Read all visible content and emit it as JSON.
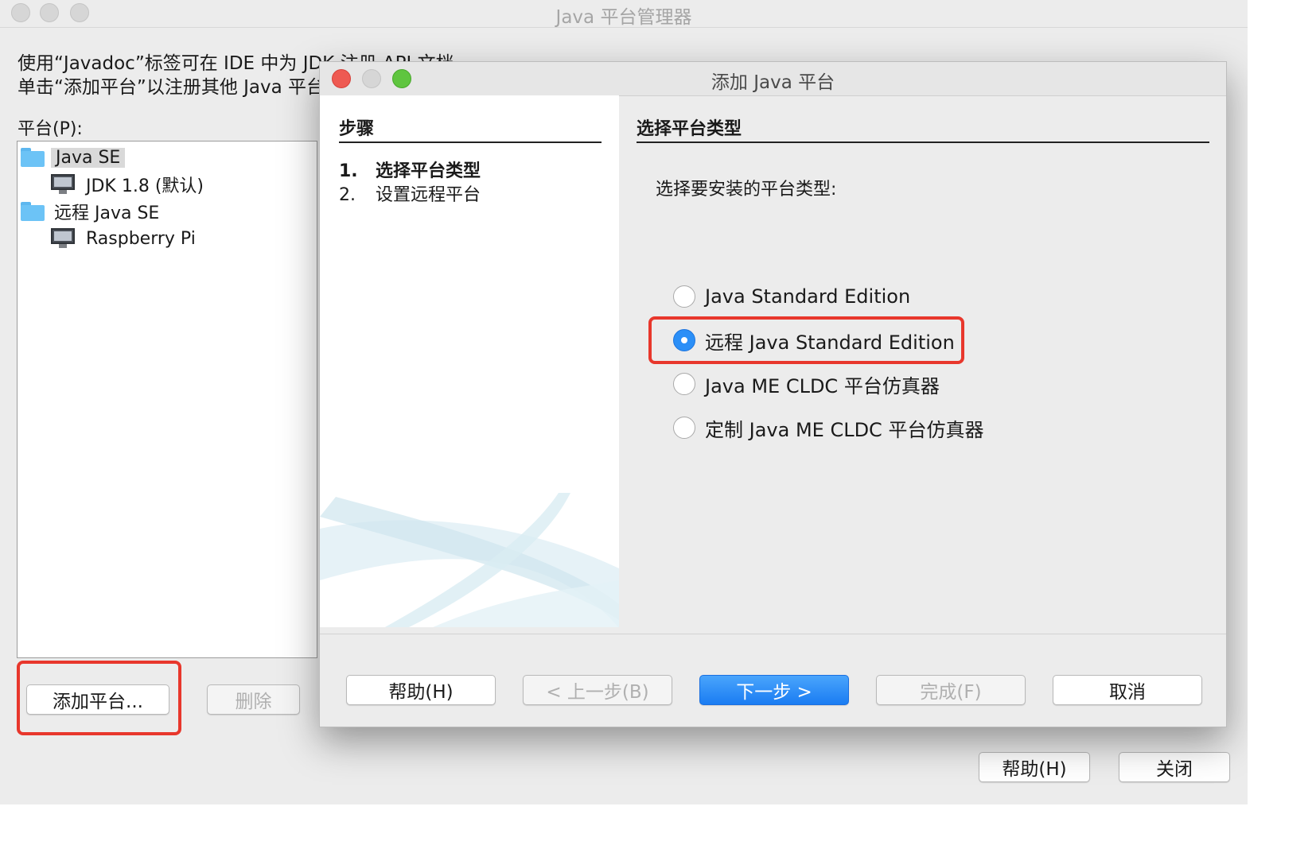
{
  "main_window": {
    "title": "Java 平台管理器",
    "instructions": [
      "使用“Javadoc”标签可在 IDE 中为 JDK 注册 API 文档",
      "单击“添加平台”以注册其他 Java 平台"
    ],
    "platforms_label": "平台(P):",
    "tree": [
      {
        "label": "Java SE",
        "type": "folder",
        "level": 0,
        "selected": true
      },
      {
        "label": "JDK 1.8 (默认)",
        "type": "platform",
        "level": 1
      },
      {
        "label": "远程 Java SE",
        "type": "folder",
        "level": 0
      },
      {
        "label": "Raspberry Pi",
        "type": "platform",
        "level": 1
      }
    ],
    "add_platform_button": "添加平台...",
    "remove_button": "删除",
    "help_button": "帮助(H)",
    "close_button": "关闭"
  },
  "dialog": {
    "title": "添加 Java 平台",
    "steps_header": "步骤",
    "steps": [
      {
        "num": "1.",
        "label": "选择平台类型",
        "active": true
      },
      {
        "num": "2.",
        "label": "设置远程平台",
        "active": false
      }
    ],
    "content_header": "选择平台类型",
    "prompt": "选择要安装的平台类型:",
    "options": [
      {
        "label": "Java Standard Edition",
        "checked": false
      },
      {
        "label": "远程 Java Standard Edition",
        "checked": true
      },
      {
        "label": "Java ME CLDC 平台仿真器",
        "checked": false
      },
      {
        "label": "定制 Java ME CLDC 平台仿真器",
        "checked": false
      }
    ],
    "buttons": {
      "help": "帮助(H)",
      "back": "< 上一步(B)",
      "next": "下一步 >",
      "finish": "完成(F)",
      "cancel": "取消"
    }
  },
  "colors": {
    "highlight": "#e8372c",
    "accent": "#1a7cf2",
    "close_light": "#ee5a52",
    "zoom_light": "#5fc53f"
  },
  "icons": {
    "folder": "folder-icon",
    "platform": "computer-monitor-icon"
  }
}
